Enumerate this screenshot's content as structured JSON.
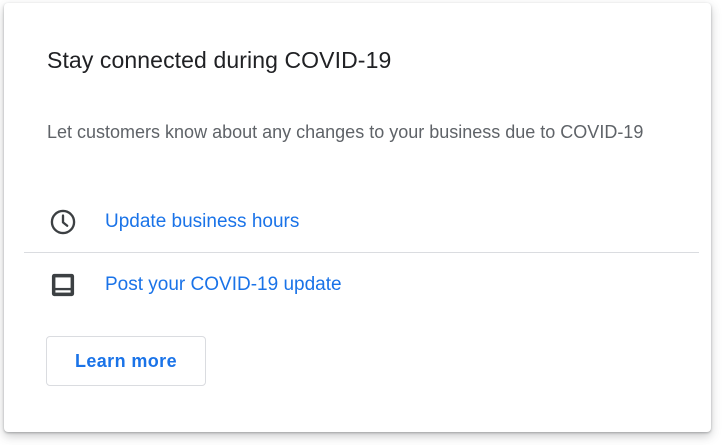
{
  "card": {
    "title": "Stay connected during COVID-19",
    "description": "Let customers know about any changes to your business due to COVID-19",
    "actions": [
      {
        "label": "Update business hours",
        "icon": "clock-icon"
      },
      {
        "label": "Post your COVID-19 update",
        "icon": "post-icon"
      }
    ],
    "learn_more_label": "Learn more"
  },
  "colors": {
    "title": "#202124",
    "description": "#5f6368",
    "link": "#1a73e8",
    "icon": "#3c4043",
    "divider": "#dadce0"
  }
}
